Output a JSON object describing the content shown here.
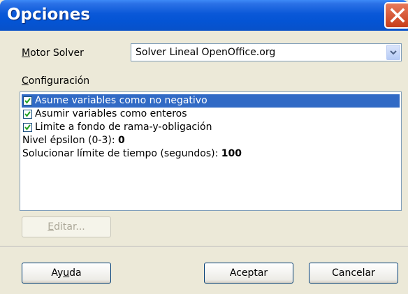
{
  "window": {
    "title": "Opciones"
  },
  "motor": {
    "label_underlined": "M",
    "label_rest": "otor Solver",
    "selected_value": "Solver Lineal OpenOffice.org"
  },
  "config": {
    "label_underlined": "C",
    "label_rest": "onfiguración",
    "options": [
      {
        "text": "Asume variables como no negativo",
        "checked": true,
        "selected": true
      },
      {
        "text": "Asumir variables como enteros",
        "checked": true,
        "selected": false
      },
      {
        "text": "Limite a fondo de rama-y-obligación",
        "checked": true,
        "selected": false
      }
    ],
    "values": [
      {
        "label": "Nivel épsilon (0-3): ",
        "value": "0"
      },
      {
        "label": "Solucionar límite de tiempo (segundos): ",
        "value": "100"
      }
    ]
  },
  "buttons": {
    "edit_underlined": "E",
    "edit_rest": "ditar...",
    "help_prefix": "Ay",
    "help_underlined": "u",
    "help_suffix": "da",
    "ok": "Aceptar",
    "cancel": "Cancelar"
  }
}
